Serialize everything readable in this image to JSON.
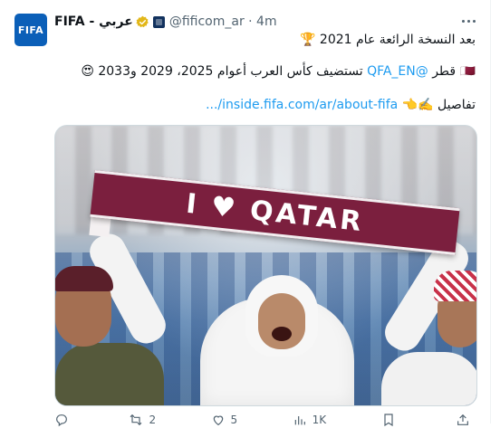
{
  "tweet": {
    "author_name": "FIFA - عربي",
    "avatar_text": "FIFA",
    "handle": "@fificom_ar · 4m",
    "line1": "بعد النسخة الرائعة عام 2021 🏆",
    "line2_prefix": "🇶🇦 قطر ",
    "line2_mention": "@QFA_EN",
    "line2_suffix": " تستضيف كأس العرب أعوام 2025، 2029 و2033 😍",
    "line3_prefix": "تفاصيل ✍️👈 ",
    "line3_link": "inside.fifa.com/ar/about-fifa/...",
    "media": {
      "scarf_text": "I ♥ QATAR"
    }
  },
  "actions": {
    "reply_count": "",
    "retweet_count": "2",
    "like_count": "5",
    "views_count": "1K",
    "bookmark_count": "",
    "share_count": ""
  },
  "icons": {
    "verified": "verified-badge-icon",
    "org_badge": "org-badge-icon",
    "more": "more-icon",
    "reply": "reply-icon",
    "retweet": "retweet-icon",
    "like": "like-icon",
    "views": "views-icon",
    "bookmark": "bookmark-icon",
    "share": "share-icon"
  },
  "colors": {
    "link": "#1d9bf0",
    "text": "#0f1419",
    "muted": "#536471",
    "avatar_bg": "#0b5fb8",
    "verified_gold": "#e2b719",
    "scarf": "#7b1f3e"
  }
}
